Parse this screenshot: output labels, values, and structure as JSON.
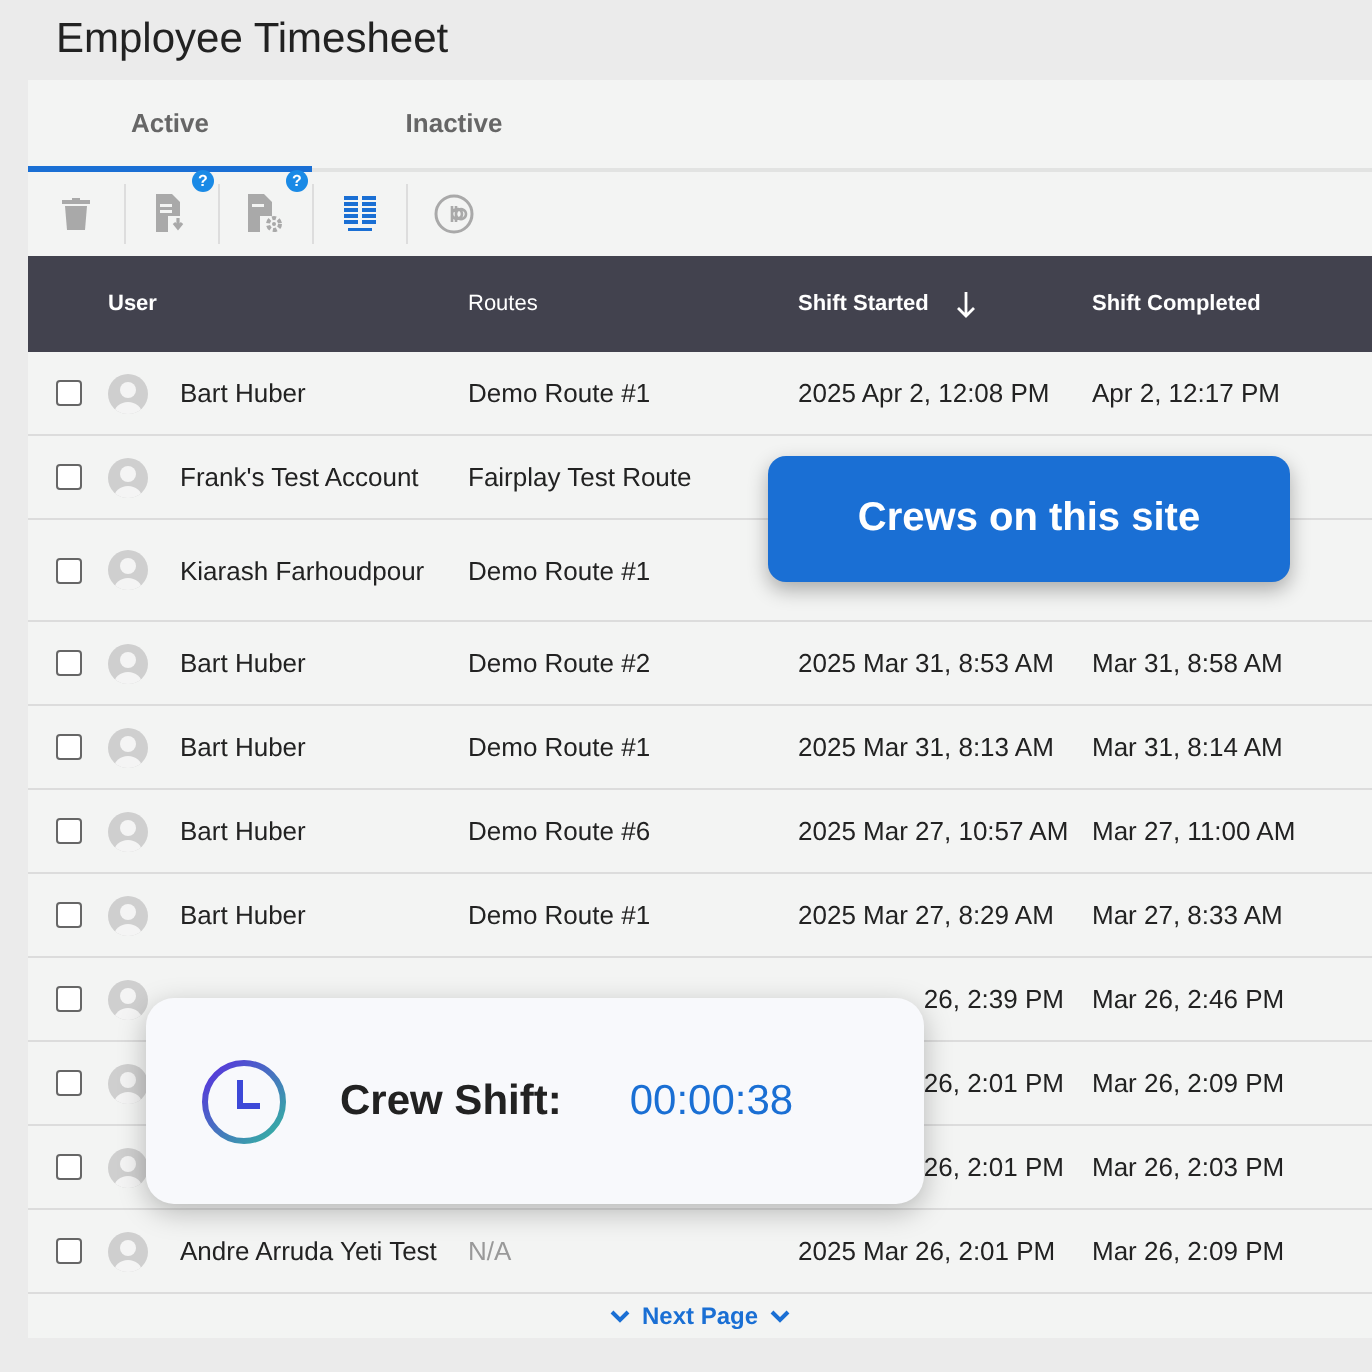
{
  "title": "Employee Timesheet",
  "tabs": [
    {
      "label": "Active",
      "selected": true
    },
    {
      "label": "Inactive",
      "selected": false
    }
  ],
  "toolbar": [
    {
      "kind": "trash",
      "active": false
    },
    {
      "kind": "file-download",
      "active": false,
      "badge": "?"
    },
    {
      "kind": "file-gear",
      "active": false,
      "badge": "?"
    },
    {
      "kind": "columns",
      "active": true
    },
    {
      "kind": "circle-logo",
      "active": false
    }
  ],
  "columns": [
    {
      "label": "User",
      "bold": true,
      "sorted": false
    },
    {
      "label": "Routes",
      "bold": false,
      "sorted": false
    },
    {
      "label": "Shift Started",
      "bold": true,
      "sorted": true
    },
    {
      "label": "Shift Completed",
      "bold": true,
      "sorted": false
    }
  ],
  "rows": [
    {
      "checked": false,
      "user": "Bart Huber",
      "route": "Demo Route #1",
      "route_missing": false,
      "started": "2025 Apr 2, 12:08 PM",
      "completed": "Apr 2, 12:17 PM"
    },
    {
      "checked": false,
      "user": "Frank's Test Account",
      "route": "Fairplay Test Route",
      "route_missing": false
    },
    {
      "checked": false,
      "tall": true,
      "user": "Kiarash Farhoudpour",
      "route": "Demo Route #1",
      "route_missing": false
    },
    {
      "checked": false,
      "user": "Bart Huber",
      "route": "Demo Route #2",
      "route_missing": false,
      "started": "2025 Mar 31, 8:53 AM",
      "completed": "Mar 31, 8:58 AM"
    },
    {
      "checked": false,
      "user": "Bart Huber",
      "route": "Demo Route #1",
      "route_missing": false,
      "started": "2025 Mar 31, 8:13 AM",
      "completed": "Mar 31, 8:14 AM"
    },
    {
      "checked": false,
      "user": "Bart Huber",
      "route": "Demo Route #6",
      "route_missing": false,
      "started": "2025 Mar 27, 10:57 AM",
      "completed": "Mar 27, 11:00 AM"
    },
    {
      "checked": false,
      "user": "Bart Huber",
      "route": "Demo Route #1",
      "route_missing": false,
      "started": "2025 Mar 27, 8:29 AM",
      "completed": "Mar 27, 8:33 AM"
    },
    {
      "checked": false,
      "started": "26, 2:39 PM",
      "started_partial": true,
      "completed": "Mar 26, 2:46 PM"
    },
    {
      "checked": false,
      "started": "26, 2:01 PM",
      "started_partial": true,
      "completed": "Mar 26, 2:09 PM"
    },
    {
      "checked": false,
      "started": "26, 2:01 PM",
      "started_partial": true,
      "completed": "Mar 26, 2:03 PM"
    },
    {
      "checked": false,
      "user": "Andre Arruda Yeti Test",
      "route": "N/A",
      "route_missing": true,
      "started": "2025 Mar 26, 2:01 PM",
      "completed": "Mar 26, 2:09 PM"
    }
  ],
  "next_page": "Next Page",
  "crews_banner": {
    "label": "Crews on this site"
  },
  "crew_shift": {
    "label": "Crew Shift:",
    "time": "00:00:38"
  }
}
